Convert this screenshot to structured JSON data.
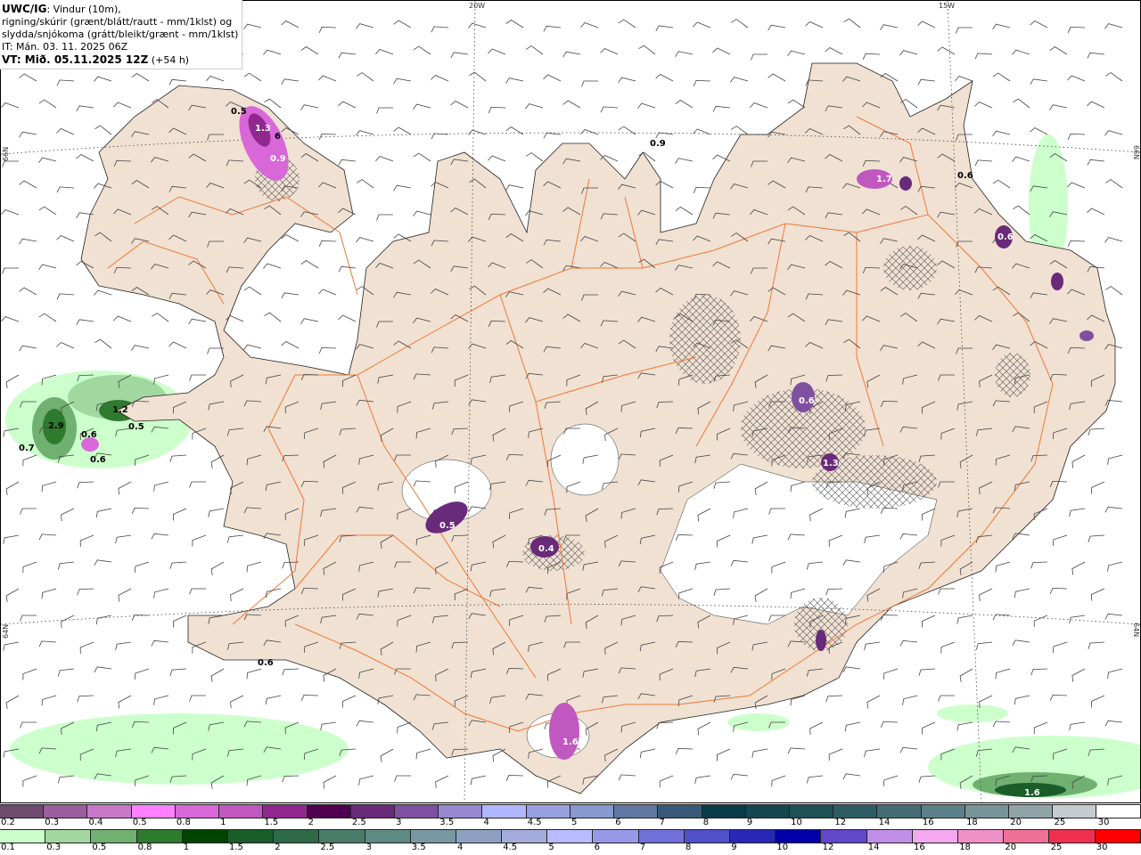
{
  "header": {
    "model": "UWC/IG",
    "line1_rest": ": Vindur (10m),",
    "line2": "rigning/skúrir (grænt/blátt/rautt - mm/1klst) og",
    "line3": "slydda/snjókoma (grátt/bleikt/grænt - mm/1klst)",
    "init_time": "IT: Mán. 03. 11. 2025 06Z",
    "valid_time_bold": "VT: Mið. 05.11.2025 12Z",
    "lead": "(+54 h)"
  },
  "graticule": {
    "lon_labels": [
      "20W",
      "15W"
    ],
    "lat_labels_left": [
      "66N",
      "64N"
    ],
    "lat_labels_right": [
      "66N",
      "64N"
    ]
  },
  "precip_labels": [
    {
      "text": "0.5",
      "color": "#000000"
    },
    {
      "text": "1.3",
      "color": "#ffffff"
    },
    {
      "text": "6",
      "color": "#000000"
    },
    {
      "text": "0.9",
      "color": "#ffffff"
    },
    {
      "text": "0.7",
      "color": "#000000"
    },
    {
      "text": "2.9",
      "color": "#000000"
    },
    {
      "text": "1.2",
      "color": "#000000"
    },
    {
      "text": "0.5",
      "color": "#000000"
    },
    {
      "text": "0.6",
      "color": "#000000"
    },
    {
      "text": "0.6",
      "color": "#000000"
    },
    {
      "text": "0.9",
      "color": "#000000"
    },
    {
      "text": "1.7",
      "color": "#ffffff"
    },
    {
      "text": "0.6",
      "color": "#000000"
    },
    {
      "text": "0.6",
      "color": "#ffffff"
    },
    {
      "text": "0.6",
      "color": "#ffffff"
    },
    {
      "text": "1.3",
      "color": "#ffffff"
    },
    {
      "text": "0.5",
      "color": "#ffffff"
    },
    {
      "text": "0.4",
      "color": "#ffffff"
    },
    {
      "text": "0.6",
      "color": "#000000"
    },
    {
      "text": "1.6",
      "color": "#ffffff"
    },
    {
      "text": "1.6",
      "color": "#ffffff"
    }
  ],
  "colors": {
    "land": "#f0e1d2",
    "roads": "#f07838",
    "glacier": "#ffffff",
    "sea": "#ffffff"
  },
  "legend_snow": {
    "labels": [
      "0.2",
      "0.3",
      "0.4",
      "0.5",
      "0.8",
      "1",
      "1.5",
      "2",
      "2.5",
      "3",
      "3.5",
      "4",
      "4.5",
      "5",
      "6",
      "7",
      "8",
      "9",
      "10",
      "12",
      "14",
      "16",
      "18",
      "20",
      "25",
      "30"
    ],
    "colors": [
      "#6e4a6e",
      "#9c5e9c",
      "#c878c8",
      "#ff80ff",
      "#d868d8",
      "#c058c0",
      "#902890",
      "#500050",
      "#6a2a7a",
      "#8050a0",
      "#9888d0",
      "#b0b8ff",
      "#98a0e0",
      "#8898d0",
      "#6078a0",
      "#385878",
      "#0a3a48",
      "#144650",
      "#1e5058",
      "#2e5c64",
      "#446c74",
      "#5c8088",
      "#789498",
      "#90a4a8",
      "#c4ccd0",
      "#ffffff"
    ]
  },
  "legend_rain": {
    "labels": [
      "0.1",
      "0.3",
      "0.5",
      "0.8",
      "1",
      "1.5",
      "2",
      "2.5",
      "3",
      "3.5",
      "4",
      "4.5",
      "5",
      "6",
      "7",
      "8",
      "9",
      "10",
      "12",
      "14",
      "16",
      "18",
      "20",
      "25",
      "30"
    ],
    "colors": [
      "#ccffcc",
      "#a0d8a0",
      "#70b070",
      "#2e7a2e",
      "#004400",
      "#1a5c2a",
      "#2e6a48",
      "#4a7c6a",
      "#5e8a84",
      "#7898a4",
      "#8ea0c0",
      "#a4acdc",
      "#b8bcff",
      "#9898e8",
      "#7070d8",
      "#5050c8",
      "#2828b8",
      "#0000a8",
      "#6048c8",
      "#c090e8",
      "#f4a8f0",
      "#f090c8",
      "#f07098",
      "#f03050",
      "#ff0000"
    ]
  }
}
